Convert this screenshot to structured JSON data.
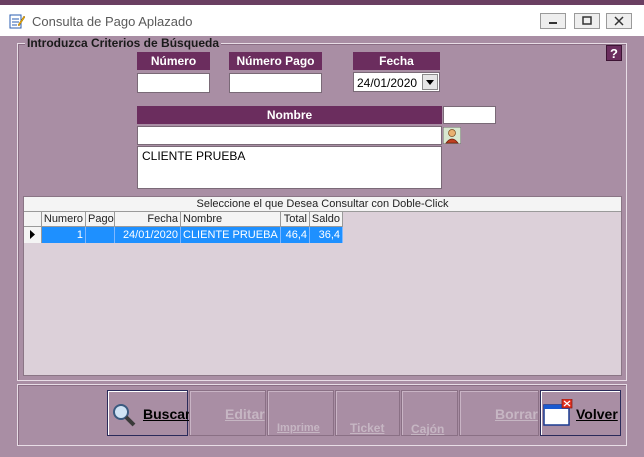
{
  "window": {
    "title": "Consulta de Pago Aplazado"
  },
  "criteria": {
    "legend": "Introduzca Criterios de Búsqueda",
    "help_label": "?",
    "numero_label": "Número",
    "numero_value": "",
    "numero_pago_label": "Número Pago",
    "numero_pago_value": "",
    "fecha_label": "Fecha",
    "fecha_value": "24/01/2020",
    "nombre_label": "Nombre",
    "nombre_code_value": "",
    "nombre_value": "",
    "nombre_list_value": "CLIENTE PRUEBA"
  },
  "grid": {
    "title": "Seleccione el que Desea Consultar con Doble-Click",
    "columns": [
      "Numero",
      "Pago",
      "Fecha",
      "Nombre",
      "Total",
      "Saldo"
    ],
    "rows": [
      {
        "numero": "1",
        "pago": "",
        "fecha": "24/01/2020",
        "nombre": "CLIENTE PRUEBA",
        "total": "46,4",
        "saldo": "36,4"
      }
    ]
  },
  "toolbar": {
    "buscar": "Buscar",
    "editar": "Editar",
    "imprime": "Imprime",
    "ticket": "Ticket",
    "cajon": "Cajón",
    "borrar": "Borrar",
    "volver": "Volver"
  },
  "colors": {
    "header_bg": "#6b2d5e",
    "form_bg": "#a98ea4",
    "selection": "#1e90ff"
  }
}
